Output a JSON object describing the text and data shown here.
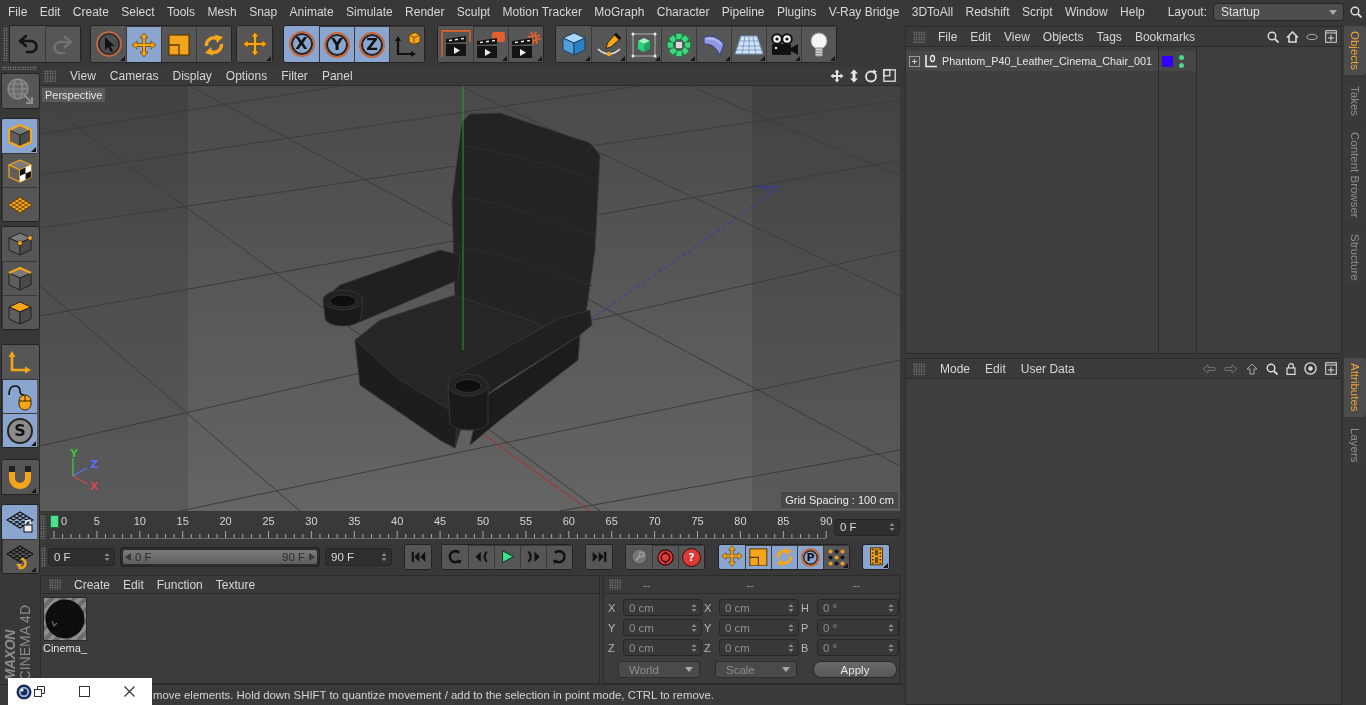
{
  "menu_bar": {
    "items": [
      "File",
      "Edit",
      "Create",
      "Select",
      "Tools",
      "Mesh",
      "Snap",
      "Animate",
      "Simulate",
      "Render",
      "Sculpt",
      "Motion Tracker",
      "MoGraph",
      "Character",
      "Pipeline",
      "Plugins",
      "V-Ray Bridge",
      "3DToAll",
      "Redshift",
      "Script",
      "Window",
      "Help"
    ],
    "layout_label": "Layout:",
    "layout_value": "Startup"
  },
  "toolbar": {
    "groups": [
      {
        "buttons": [
          {
            "kind": "undo",
            "disabled": false
          },
          {
            "kind": "redo",
            "disabled": true
          }
        ]
      },
      {
        "buttons": [
          {
            "kind": "select",
            "selected": false
          },
          {
            "kind": "move",
            "selected": true
          },
          {
            "kind": "scale",
            "selected": false
          },
          {
            "kind": "rotate",
            "selected": false
          }
        ]
      },
      {
        "buttons": [
          {
            "kind": "recent"
          }
        ]
      },
      {
        "buttons": [
          {
            "kind": "axis",
            "label": "X",
            "selected": true
          },
          {
            "kind": "axis",
            "label": "Y",
            "selected": true
          },
          {
            "kind": "axis",
            "label": "Z",
            "selected": true
          },
          {
            "kind": "coordinates",
            "selected": false
          }
        ]
      },
      {
        "buttons": [
          {
            "kind": "renderview"
          },
          {
            "kind": "renderpicture"
          },
          {
            "kind": "rendersettings"
          }
        ]
      },
      {
        "buttons": [
          {
            "kind": "cube"
          },
          {
            "kind": "pen"
          },
          {
            "kind": "subdivision"
          },
          {
            "kind": "cloner"
          },
          {
            "kind": "deformer"
          },
          {
            "kind": "floor"
          },
          {
            "kind": "camera"
          },
          {
            "kind": "light"
          }
        ]
      }
    ]
  },
  "left_toolbar": {
    "groups": [
      {
        "buttons": [
          {
            "kind": "editable",
            "disabled": true
          }
        ]
      },
      {
        "buttons": [
          {
            "kind": "model",
            "selected": true
          },
          {
            "kind": "texture",
            "selected": false
          },
          {
            "kind": "workplane",
            "selected": false
          }
        ]
      },
      {
        "buttons": [
          {
            "kind": "points",
            "selected": false
          },
          {
            "kind": "edges",
            "selected": false
          },
          {
            "kind": "polygons",
            "selected": false
          }
        ]
      },
      {
        "buttons": [
          {
            "kind": "axismode",
            "selected": false
          },
          {
            "kind": "tweak",
            "selected": true
          },
          {
            "kind": "solo",
            "label": "S",
            "selected": true
          }
        ]
      },
      {
        "buttons": [
          {
            "kind": "snap",
            "selected": false
          }
        ]
      },
      {
        "buttons": [
          {
            "kind": "lockplane",
            "selected": true
          },
          {
            "kind": "alignplane",
            "selected": false
          }
        ]
      }
    ]
  },
  "brand": {
    "maker": "MAXON",
    "product": "CINEMA 4D"
  },
  "viewport": {
    "menu": [
      "View",
      "Cameras",
      "Display",
      "Options",
      "Filter",
      "Panel"
    ],
    "camera": "Perspective",
    "grid_spacing": "Grid Spacing : 100 cm",
    "axes": [
      {
        "label": "Y",
        "color": "#3ec23e"
      },
      {
        "label": "Z",
        "color": "#5a6cff"
      },
      {
        "label": "X",
        "color": "#d84848"
      }
    ]
  },
  "timeline": {
    "labels": [
      "0",
      "5",
      "10",
      "15",
      "20",
      "25",
      "30",
      "35",
      "40",
      "45",
      "50",
      "55",
      "60",
      "65",
      "70",
      "75",
      "80",
      "85",
      "90"
    ],
    "level": 0,
    "frame_field": "0 F"
  },
  "playback": {
    "start_field": "0 F",
    "range": {
      "start": "0 F",
      "end": "90 F",
      "level": 1
    },
    "end_field": "90 F",
    "groups": [
      {
        "buttons": [
          {
            "kind": "first"
          }
        ]
      },
      {
        "buttons": [
          {
            "kind": "prevkey"
          },
          {
            "kind": "prevframe"
          },
          {
            "kind": "play"
          },
          {
            "kind": "nextframe"
          },
          {
            "kind": "nextkey"
          }
        ]
      },
      {
        "buttons": [
          {
            "kind": "last"
          }
        ]
      },
      {
        "buttons": [
          {
            "kind": "key",
            "disabled": true
          },
          {
            "kind": "record",
            "disabled": false
          },
          {
            "kind": "help",
            "label": "?",
            "disabled": false
          }
        ]
      },
      {
        "buttons": [
          {
            "kind": "position",
            "selected": true
          },
          {
            "kind": "scalekey",
            "selected": true
          },
          {
            "kind": "rotationkey",
            "selected": true
          },
          {
            "kind": "parameter",
            "label": "P",
            "selected": true
          },
          {
            "kind": "pla",
            "selected": false
          }
        ]
      },
      {
        "buttons": [
          {
            "kind": "timeline",
            "selected": true
          }
        ]
      }
    ]
  },
  "materials": {
    "menu": [
      "Create",
      "Edit",
      "Function",
      "Texture"
    ],
    "items": [
      {
        "name": "Cinema_"
      }
    ]
  },
  "coordinates": {
    "headers": [
      "--",
      "--",
      "--"
    ],
    "rows": [
      [
        {
          "label": "X",
          "value": "0 cm"
        },
        {
          "label": "X",
          "value": "0 cm"
        },
        {
          "label": "H",
          "value": "0 °"
        }
      ],
      [
        {
          "label": "Y",
          "value": "0 cm"
        },
        {
          "label": "Y",
          "value": "0 cm"
        },
        {
          "label": "P",
          "value": "0 °"
        }
      ],
      [
        {
          "label": "Z",
          "value": "0 cm"
        },
        {
          "label": "Z",
          "value": "0 cm"
        },
        {
          "label": "B",
          "value": "0 °"
        }
      ]
    ],
    "dropdowns": [
      "World",
      "Scale"
    ],
    "apply": "Apply"
  },
  "status_bar": {
    "text": "move elements. Hold down SHIFT to quantize movement / add to the selection in point mode, CTRL to remove."
  },
  "object_manager": {
    "menu": [
      "File",
      "Edit",
      "View",
      "Objects",
      "Tags",
      "Bookmarks"
    ],
    "objects": [
      {
        "name": "Phantom_P40_Leather_Cinema_Chair_001",
        "expanded": false,
        "selected": false,
        "color": "#3300ff",
        "editor_visible": true,
        "render_visible": true
      }
    ]
  },
  "attribute_manager": {
    "menu": [
      "Mode",
      "Edit",
      "User Data"
    ]
  },
  "side_tabs": {
    "upper": [
      {
        "label": "Objects",
        "selected": true
      },
      {
        "label": "Takes",
        "selected": false
      },
      {
        "label": "Content Browser",
        "selected": false
      },
      {
        "label": "Structure",
        "selected": false
      }
    ],
    "lower": [
      {
        "label": "Attributes",
        "selected": true
      },
      {
        "label": "Layers",
        "selected": false
      }
    ]
  }
}
